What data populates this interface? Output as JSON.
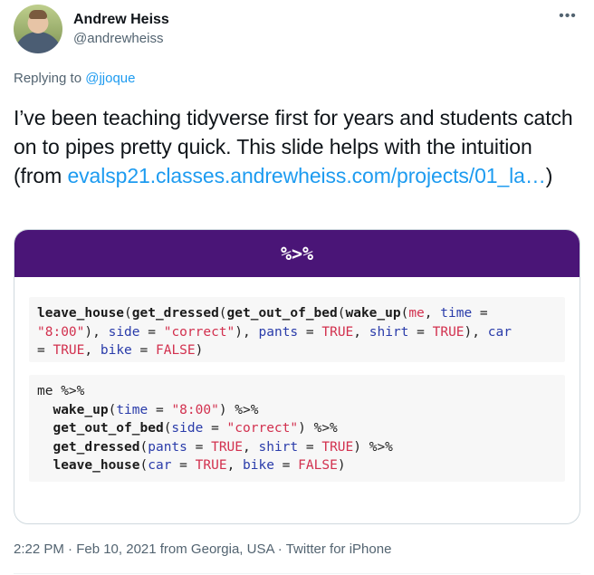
{
  "author": {
    "display_name": "Andrew Heiss",
    "handle": "@andrewheiss",
    "avatar_icon": "user-avatar"
  },
  "more_icon": "more-icon",
  "reply": {
    "prefix": "Replying to ",
    "mention": "@jjoque"
  },
  "tweet": {
    "text": "I’ve been teaching tidyverse first for years and students catch on to pipes pretty quick. This slide helps with the intuition (from ",
    "link": "evalsp21.classes.andrewheiss.com/projects/01_la…",
    "suffix": ")"
  },
  "slide": {
    "title": "%>%",
    "colors": {
      "title_bg": "#4a1577",
      "string": "#d2304e",
      "argument": "#2a3caa"
    },
    "nested_code": {
      "line1": {
        "f1": "leave_house",
        "p1": "(",
        "f2": "get_dressed",
        "p2": "(",
        "f3": "get_out_of_bed",
        "p3": "(",
        "f4": "wake_up",
        "p4": "(",
        "me": "me",
        "c1": ", ",
        "a1": "time",
        "eq1": " ="
      },
      "line2": {
        "s1": "\"8:00\"",
        "t1": "), ",
        "a2": "side",
        "eq2": " = ",
        "s2": "\"correct\"",
        "t2": "), ",
        "a3": "pants",
        "eq3": " = ",
        "k1": "TRUE",
        "t3": ", ",
        "a4": "shirt",
        "eq4": " = ",
        "k2": "TRUE",
        "t4": "), ",
        "a5": "car"
      },
      "line3": {
        "eq5": "= ",
        "k3": "TRUE",
        "t5": ", ",
        "a6": "bike",
        "eq6": " = ",
        "k4": "FALSE",
        "t6": ")"
      }
    },
    "piped_code": {
      "line1": "me %>%",
      "line2": {
        "indent": "  ",
        "fn": "wake_up",
        "open": "(",
        "arg": "time",
        "eq": " = ",
        "str": "\"8:00\"",
        "close": ") %>%"
      },
      "line3": {
        "indent": "  ",
        "fn": "get_out_of_bed",
        "open": "(",
        "arg": "side",
        "eq": " = ",
        "str": "\"correct\"",
        "close": ") %>%"
      },
      "line4": {
        "indent": "  ",
        "fn": "get_dressed",
        "open": "(",
        "arg1": "pants",
        "eq1": " = ",
        "k1": "TRUE",
        "sep": ", ",
        "arg2": "shirt",
        "eq2": " = ",
        "k2": "TRUE",
        "close": ") %>%"
      },
      "line5": {
        "indent": "  ",
        "fn": "leave_house",
        "open": "(",
        "arg1": "car",
        "eq1": " = ",
        "k1": "TRUE",
        "sep": ", ",
        "arg2": "bike",
        "eq2": " = ",
        "k2": "FALSE",
        "close": ")"
      }
    }
  },
  "meta": {
    "timestamp": "2:22 PM · Feb 10, 2021 from Georgia, USA · Twitter for iPhone"
  }
}
